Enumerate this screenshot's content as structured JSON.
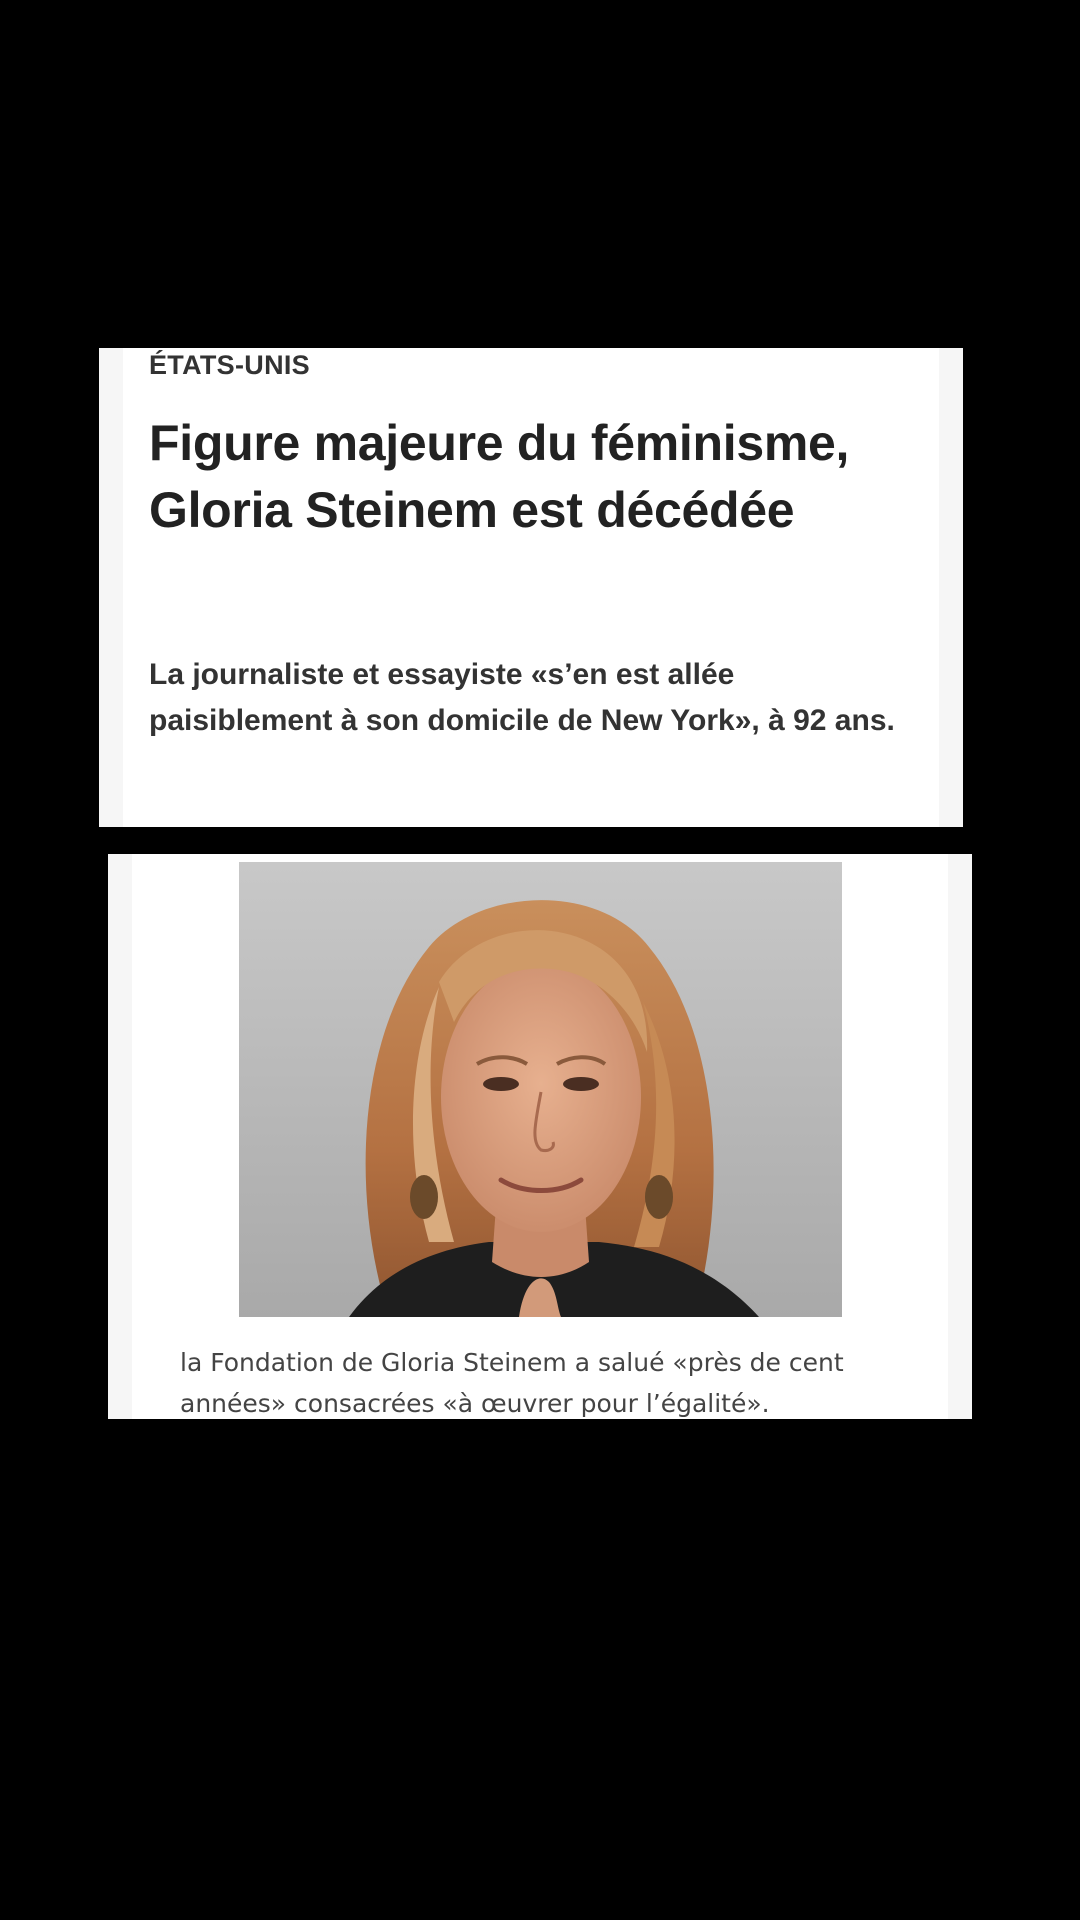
{
  "article": {
    "kicker": "ÉTATS-UNIS",
    "headline": "Figure majeure du féminisme, Gloria Steinem est décédée",
    "standfirst": "La journaliste et essayiste «s’en est allée paisiblement à son domicile de New York», à 92 ans."
  },
  "photo": {
    "caption": "la Fondation de Gloria Steinem a salué «près de cent années» consacrées «à œuvrer pour l’égalité»."
  },
  "colors": {
    "background": "#000000",
    "card": "#ffffff",
    "headline_text": "#222222",
    "caption_text": "#444444"
  }
}
